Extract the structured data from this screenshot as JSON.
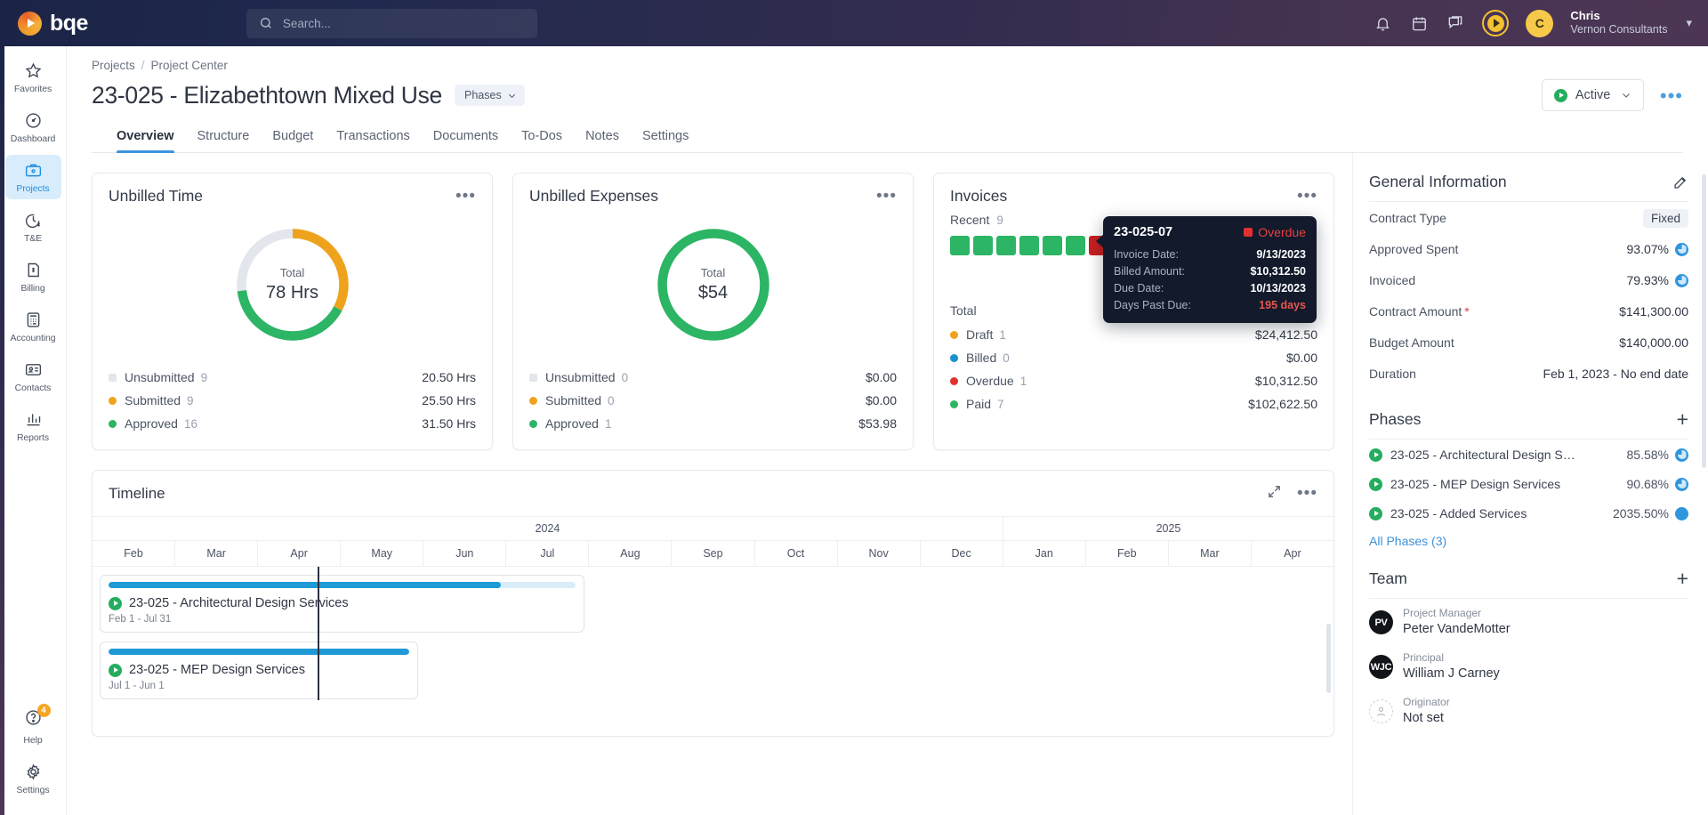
{
  "topbar": {
    "brand": "bqe",
    "search_placeholder": "Search...",
    "search_value": "",
    "icons": [
      "bell-icon",
      "calendar-icon",
      "chat-icon",
      "timer-icon"
    ],
    "user": {
      "initial": "C",
      "name": "Chris",
      "org": "Vernon Consultants"
    }
  },
  "rail": {
    "items": [
      {
        "label": "Favorites",
        "icon": "star-icon",
        "active": false
      },
      {
        "label": "Dashboard",
        "icon": "gauge-icon",
        "active": false
      },
      {
        "label": "Projects",
        "icon": "briefcase-icon",
        "active": true
      },
      {
        "label": "T&E",
        "icon": "clock-dollar-icon",
        "active": false
      },
      {
        "label": "Billing",
        "icon": "invoice-dollar-icon",
        "active": false
      },
      {
        "label": "Accounting",
        "icon": "calculator-icon",
        "active": false
      },
      {
        "label": "Contacts",
        "icon": "contact-card-icon",
        "active": false
      },
      {
        "label": "Reports",
        "icon": "chart-icon",
        "active": false
      }
    ],
    "bottom": [
      {
        "label": "Help",
        "icon": "help-icon",
        "badge": "4"
      },
      {
        "label": "Settings",
        "icon": "gear-icon",
        "badge": ""
      }
    ]
  },
  "header": {
    "breadcrumb": {
      "root": "Projects",
      "sep": "/",
      "current": "Project Center"
    },
    "title": "23-025 - Elizabethtown Mixed Use",
    "phases_button": "Phases",
    "status": "Active",
    "more_label": "•••"
  },
  "tabs": [
    {
      "label": "Overview",
      "active": true
    },
    {
      "label": "Structure",
      "active": false
    },
    {
      "label": "Budget",
      "active": false
    },
    {
      "label": "Transactions",
      "active": false
    },
    {
      "label": "Documents",
      "active": false
    },
    {
      "label": "To-Dos",
      "active": false
    },
    {
      "label": "Notes",
      "active": false
    },
    {
      "label": "Settings",
      "active": false
    }
  ],
  "chart_data": [
    {
      "type": "pie",
      "title": "Unbilled Time",
      "center_label": "Total",
      "center_value": "78 Hrs",
      "total": 78,
      "categories": [
        "Unsubmitted",
        "Submitted",
        "Approved"
      ],
      "values": [
        20.5,
        25.5,
        31.5
      ],
      "counts": [
        9,
        9,
        16
      ],
      "value_labels": [
        "20.50 Hrs",
        "25.50 Hrs",
        "31.50 Hrs"
      ],
      "colors": [
        "#e3e6ec",
        "#efa31d",
        "#2cb564"
      ],
      "legend": "bottom"
    },
    {
      "type": "pie",
      "title": "Unbilled Expenses",
      "center_label": "Total",
      "center_value": "$54",
      "total": 53.98,
      "categories": [
        "Unsubmitted",
        "Submitted",
        "Approved"
      ],
      "values": [
        0,
        0,
        53.98
      ],
      "counts": [
        0,
        0,
        1
      ],
      "value_labels": [
        "$0.00",
        "$0.00",
        "$53.98"
      ],
      "colors": [
        "#e3e6ec",
        "#efa31d",
        "#2cb564"
      ],
      "legend": "bottom"
    },
    {
      "type": "bar",
      "title": "Invoices",
      "subtitle": "Recent",
      "recent_count": "9",
      "squares": [
        "paid",
        "paid",
        "paid",
        "paid",
        "paid",
        "paid",
        "overdue",
        "paid",
        "paid"
      ],
      "square_colors": {
        "paid": "#2cb564",
        "overdue": "#c62020",
        "draft": "#efa31d",
        "billed": "#1b90cf"
      },
      "total_label": "Total",
      "categories": [
        "Draft",
        "Billed",
        "Overdue",
        "Paid"
      ],
      "counts": [
        1,
        0,
        1,
        7
      ],
      "values": [
        24412.5,
        0,
        10312.5,
        102622.5
      ],
      "value_labels": [
        "$24,412.50",
        "$0.00",
        "$10,312.50",
        "$102,622.50"
      ],
      "colors": [
        "#efa31d",
        "#1b90cf",
        "#e03131",
        "#2cb564"
      ]
    },
    {
      "type": "bar",
      "title": "Timeline",
      "years": [
        {
          "label": "2024",
          "span": 11
        },
        {
          "label": "2025",
          "span": 4
        }
      ],
      "months": [
        "Feb",
        "Mar",
        "Apr",
        "May",
        "Jun",
        "Jul",
        "Aug",
        "Sep",
        "Oct",
        "Nov",
        "Dec",
        "Jan",
        "Feb",
        "Mar",
        "Apr"
      ],
      "tasks": [
        {
          "name": "23-025 - Architectural Design Services",
          "dates": "Feb 1 - Jul 31",
          "start_month": 0,
          "span_months": 6,
          "progress_pct": 84
        },
        {
          "name": "23-025 - MEP Design Services",
          "dates": "Jul 1 - Jun 1",
          "start_month": 0,
          "span_months": 4,
          "progress_pct": 100
        }
      ],
      "today_marker_month": 2.1
    }
  ],
  "cards": {
    "unbilled_time": {
      "title": "Unbilled Time",
      "menu": "•••",
      "center_label": "Total",
      "center_value": "78 Hrs",
      "rows": [
        {
          "label": "Unsubmitted",
          "count": "9",
          "value": "20.50 Hrs",
          "color": "#e3e6ec"
        },
        {
          "label": "Submitted",
          "count": "9",
          "value": "25.50 Hrs",
          "color": "#efa31d"
        },
        {
          "label": "Approved",
          "count": "16",
          "value": "31.50 Hrs",
          "color": "#2cb564"
        }
      ]
    },
    "unbilled_expenses": {
      "title": "Unbilled Expenses",
      "menu": "•••",
      "center_label": "Total",
      "center_value": "$54",
      "rows": [
        {
          "label": "Unsubmitted",
          "count": "0",
          "value": "$0.00",
          "color": "#e3e6ec"
        },
        {
          "label": "Submitted",
          "count": "0",
          "value": "$0.00",
          "color": "#efa31d"
        },
        {
          "label": "Approved",
          "count": "1",
          "value": "$53.98",
          "color": "#2cb564"
        }
      ]
    },
    "invoices": {
      "title": "Invoices",
      "menu": "•••",
      "recent_label": "Recent",
      "recent_count": "9",
      "total_label": "Total",
      "rows": [
        {
          "label": "Draft",
          "count": "1",
          "value": "$24,412.50",
          "color": "#efa31d"
        },
        {
          "label": "Billed",
          "count": "0",
          "value": "$0.00",
          "color": "#1b90cf"
        },
        {
          "label": "Overdue",
          "count": "1",
          "value": "$10,312.50",
          "color": "#e03131"
        },
        {
          "label": "Paid",
          "count": "7",
          "value": "$102,622.50",
          "color": "#2cb564"
        }
      ],
      "tooltip": {
        "invoice_id": "23-025-07",
        "status": "Overdue",
        "rows": [
          {
            "key": "Invoice Date:",
            "value": "9/13/2023"
          },
          {
            "key": "Billed Amount:",
            "value": "$10,312.50"
          },
          {
            "key": "Due Date:",
            "value": "10/13/2023"
          },
          {
            "key": "Days Past Due:",
            "value": "195 days"
          }
        ]
      }
    }
  },
  "timeline": {
    "title": "Timeline",
    "menu": "•••",
    "years": [
      "2024",
      "2025"
    ],
    "months": [
      "Feb",
      "Mar",
      "Apr",
      "May",
      "Jun",
      "Jul",
      "Aug",
      "Sep",
      "Oct",
      "Nov",
      "Dec",
      "Jan",
      "Feb",
      "Mar",
      "Apr"
    ],
    "tasks": [
      {
        "name": "23-025 - Architectural Design Services",
        "dates": "Feb 1 - Jul 31"
      },
      {
        "name": "23-025 - MEP Design Services",
        "dates": "Jul 1 - Jun 1"
      }
    ]
  },
  "general_information": {
    "title": "General Information",
    "rows": [
      {
        "label": "Contract Type",
        "value": "Fixed",
        "kind": "chip"
      },
      {
        "label": "Approved Spent",
        "value": "93.07%",
        "kind": "pct"
      },
      {
        "label": "Invoiced",
        "value": "79.93%",
        "kind": "pct"
      },
      {
        "label": "Contract Amount",
        "value": "$141,300.00",
        "kind": "text",
        "required": true
      },
      {
        "label": "Budget Amount",
        "value": "$140,000.00",
        "kind": "text"
      },
      {
        "label": "Duration",
        "value": "Feb 1, 2023 - No end date",
        "kind": "text"
      }
    ]
  },
  "phases": {
    "title": "Phases",
    "add_label": "+",
    "items": [
      {
        "name": "23-025 - Architectural Design Ser...",
        "pct": "85.58%"
      },
      {
        "name": "23-025 - MEP Design Services",
        "pct": "90.68%"
      },
      {
        "name": "23-025 - Added Services",
        "pct": "2035.50%"
      }
    ],
    "all_link": "All Phases (3)"
  },
  "team": {
    "title": "Team",
    "add_label": "+",
    "members": [
      {
        "initials": "PV",
        "role": "Project Manager",
        "name": "Peter VandeMotter"
      },
      {
        "initials": "WJC",
        "role": "Principal",
        "name": "William J Carney"
      },
      {
        "initials": "",
        "role": "Originator",
        "name": "Not set"
      }
    ]
  }
}
